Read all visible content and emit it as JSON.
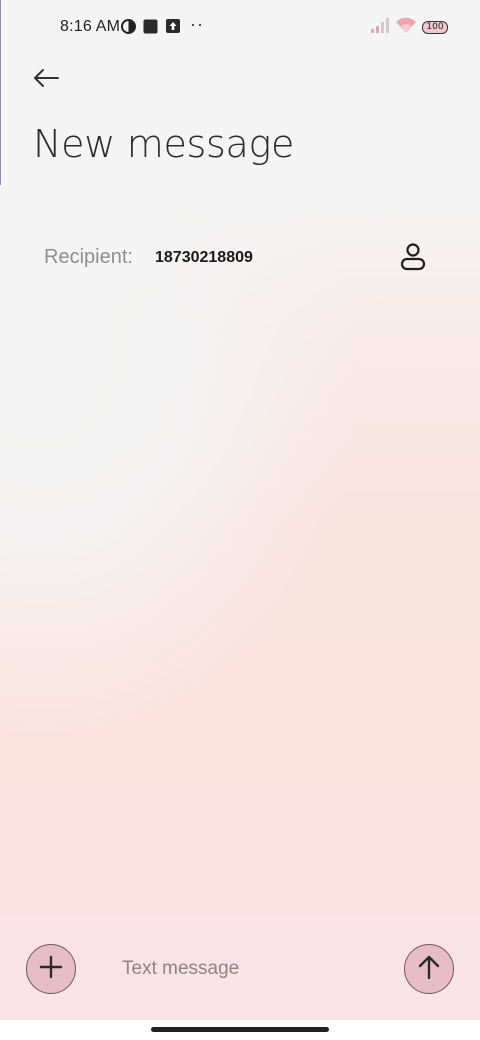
{
  "status_bar": {
    "time": "8:16 AM",
    "icons": [
      "data-saver-icon",
      "square-notification-icon",
      "upload-notification-icon",
      "more-notifications-icon",
      "signal-icon",
      "wifi-icon",
      "battery-icon"
    ],
    "more_dots": "··",
    "battery_level": "100"
  },
  "header": {
    "back_icon": "arrow-left-icon",
    "title": "New message"
  },
  "recipient": {
    "label": "Recipient:",
    "value": "18730218809",
    "contact_icon": "person-icon"
  },
  "compose": {
    "attach_icon": "plus-icon",
    "placeholder": "Text message",
    "value": "",
    "send_icon": "arrow-up-icon"
  },
  "colors": {
    "accent_button": "#e6bcc7",
    "compose_background": "#f9e3e8",
    "gradient_pink": "#fbe2dd",
    "title_text": "#2a2a2a"
  }
}
